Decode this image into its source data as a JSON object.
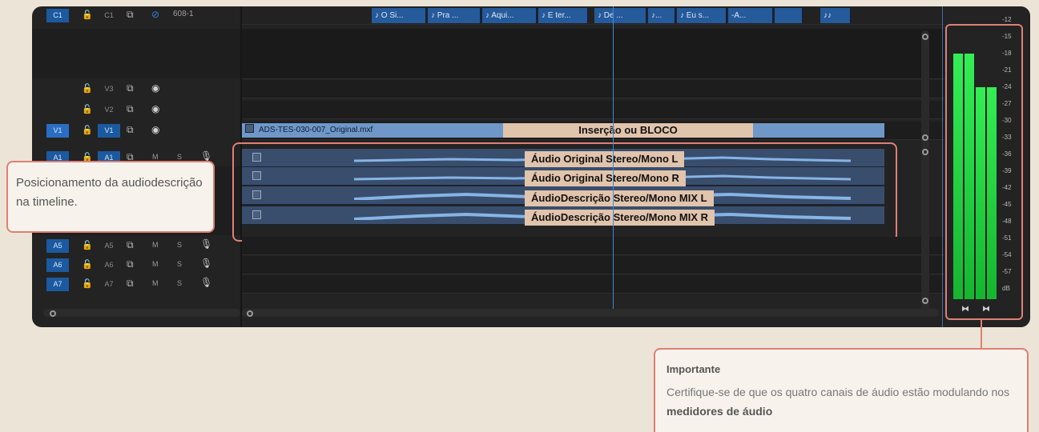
{
  "tracks": {
    "c1": {
      "target": "C1",
      "patch": "C1",
      "name": "608-1"
    },
    "v3": {
      "patch": "V3"
    },
    "v2": {
      "patch": "V2"
    },
    "v1": {
      "target": "V1",
      "patch": "V1"
    },
    "a1": {
      "target": "A1",
      "patch": "A1",
      "m": "M",
      "s": "S"
    },
    "a5": {
      "target": "A5",
      "patch": "A5",
      "m": "M",
      "s": "S"
    },
    "a6": {
      "target": "A6",
      "patch": "A6",
      "m": "M",
      "s": "S"
    },
    "a7": {
      "target": "A7",
      "patch": "A7",
      "m": "M",
      "s": "S"
    }
  },
  "music_clips": [
    "♪ O Si...",
    "♪ Pra ...",
    "♪ Aqui...",
    "♪ E ter...",
    "♪ De ...",
    "♪...",
    "♪ Eu s...",
    "-A...",
    "",
    "♪♪"
  ],
  "video_clip": {
    "name": "ADS-TES-030-007_Original.mxf",
    "label": "Inserção ou BLOCO"
  },
  "audio_labels": [
    "Áudio Original Stereo/Mono L",
    "Áudio Original Stereo/Mono R",
    "ÁudioDescrição Stereo/Mono MIX L",
    "ÁudioDescrição Stereo/Mono MIX R"
  ],
  "meter": {
    "ticks": [
      "-12",
      "-15",
      "-18",
      "-21",
      "-24",
      "-27",
      "-30",
      "-33",
      "-36",
      "-39",
      "-42",
      "-45",
      "-48",
      "-51",
      "-54",
      "-57",
      "dB"
    ],
    "levels_db": [
      -18,
      -18,
      -24,
      -24
    ],
    "buttons": [
      "⧓",
      "⧓"
    ]
  },
  "callout_left": {
    "text": "Posicionamento da audiodescrição na timeline."
  },
  "callout_bottom": {
    "title": "Importante",
    "text_before": "Certifique-se de que os quatro canais de áudio estão modulando nos",
    "bold": "medidores de áudio"
  },
  "colors": {
    "accent": "#e07f74",
    "target_blue": "#1b5aa0",
    "meter_green": "#22cc44"
  }
}
